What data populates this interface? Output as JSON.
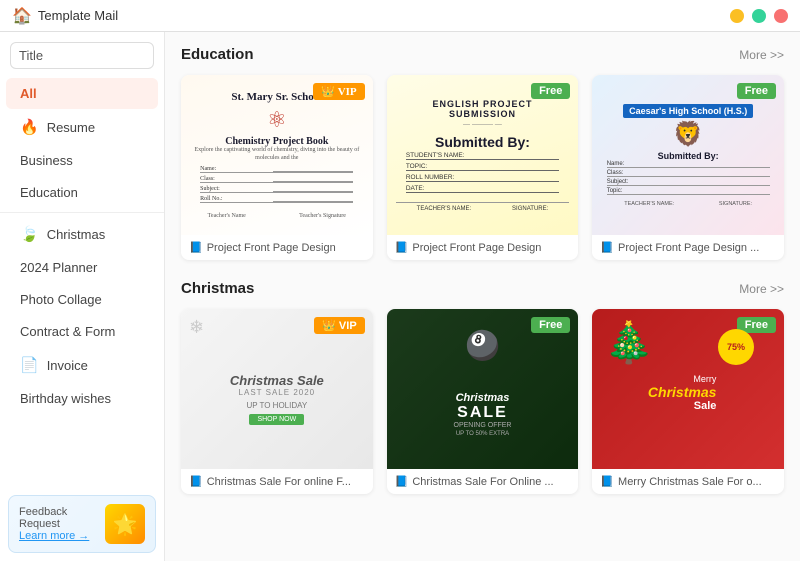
{
  "app": {
    "title": "Template Mail"
  },
  "titlebar": {
    "title": "Template Mail",
    "min_label": "−",
    "max_label": "□",
    "close_label": "×"
  },
  "search": {
    "placeholder": "Title",
    "value": "Title"
  },
  "sidebar": {
    "items": [
      {
        "id": "all",
        "label": "All",
        "icon": "",
        "active": true
      },
      {
        "id": "resume",
        "label": "Resume",
        "icon": "fire",
        "active": false
      },
      {
        "id": "business",
        "label": "Business",
        "icon": "",
        "active": false
      },
      {
        "id": "education",
        "label": "Education",
        "icon": "",
        "active": false
      },
      {
        "id": "christmas",
        "label": "Christmas",
        "icon": "leaf",
        "active": false
      },
      {
        "id": "planner",
        "label": "2024 Planner",
        "icon": "",
        "active": false
      },
      {
        "id": "photo-collage",
        "label": "Photo Collage",
        "icon": "",
        "active": false
      },
      {
        "id": "contract",
        "label": "Contract & Form",
        "icon": "",
        "active": false
      },
      {
        "id": "invoice",
        "label": "Invoice",
        "icon": "invoice",
        "active": false
      },
      {
        "id": "birthday",
        "label": "Birthday wishes",
        "icon": "",
        "active": false
      }
    ]
  },
  "feedback": {
    "label": "Feedback Request",
    "link_text": "Learn more →",
    "emoji": "🌟"
  },
  "sections": {
    "education": {
      "title": "Education",
      "more": "More >>",
      "cards": [
        {
          "badge": "VIP",
          "badge_type": "vip",
          "school": "St. Mary Sr. School",
          "subtitle": "Chemistry Project Book",
          "footer": "Project Front Page Design"
        },
        {
          "badge": "Free",
          "badge_type": "free",
          "school": "ENGLISH PROJECT SUBMISSION",
          "subtitle": "Submitted By:",
          "footer": "Project Front Page Design"
        },
        {
          "badge": "Free",
          "badge_type": "free",
          "school": "Caesar's High School (H.S.)",
          "subtitle": "Submitted By:",
          "footer": "Project Front Page Design ..."
        }
      ]
    },
    "christmas": {
      "title": "Christmas",
      "more": "More >>",
      "cards": [
        {
          "badge": "VIP",
          "badge_type": "vip",
          "title": "Christmas Sale",
          "subtitle": "LAST SALE 2020",
          "desc": "UP TO HOLIDAY",
          "footer": "Christmas Sale For online F..."
        },
        {
          "badge": "Free",
          "badge_type": "free",
          "title": "Christmas SALE",
          "subtitle": "OPENING OFFER",
          "desc": "UP TO 50% EXTRA",
          "footer": "Christmas Sale For Online ..."
        },
        {
          "badge": "Free",
          "badge_type": "free",
          "title": "Merry Christmas Sale",
          "subtitle": "75%",
          "desc": "Sale",
          "footer": "Merry Christmas Sale For o..."
        }
      ]
    }
  }
}
